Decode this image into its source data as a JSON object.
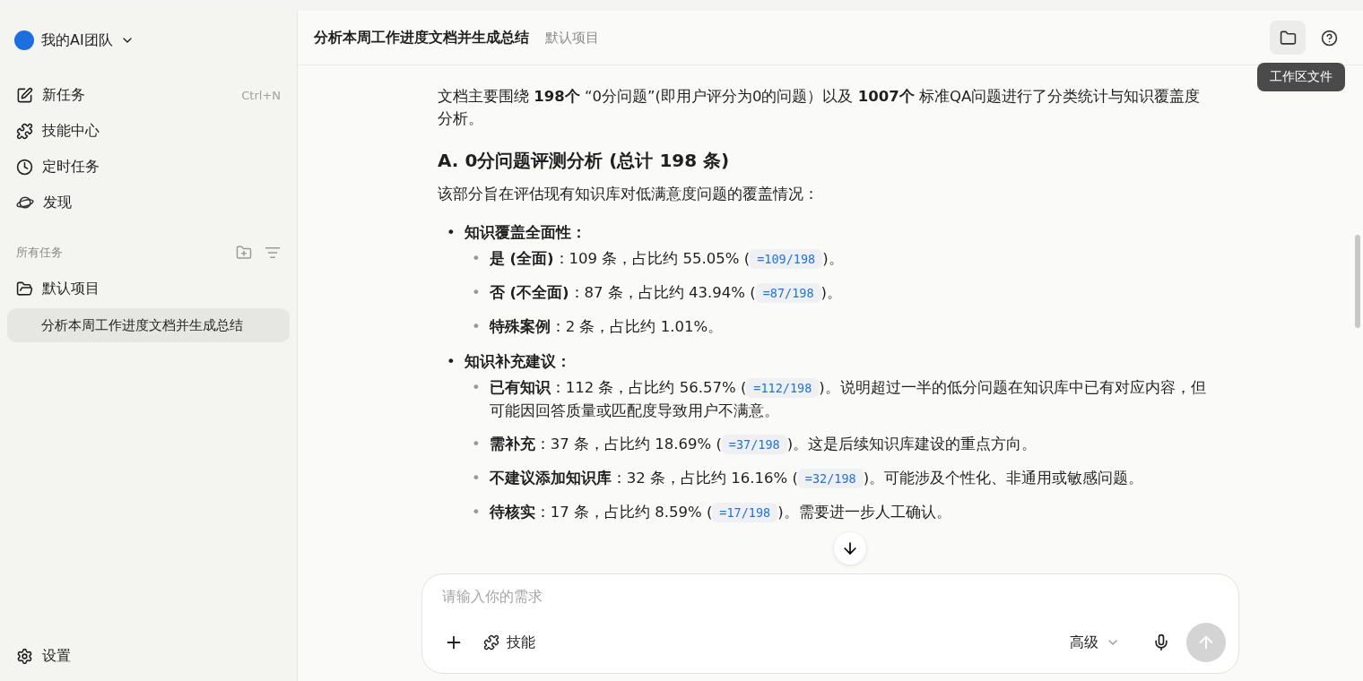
{
  "sidebar": {
    "team": "我的AI团队",
    "nav": [
      {
        "kind": "new",
        "label": "新任务",
        "shortcut": "Ctrl+N"
      },
      {
        "kind": "skills",
        "label": "技能中心"
      },
      {
        "kind": "schedule",
        "label": "定时任务"
      },
      {
        "kind": "discover",
        "label": "发现"
      }
    ],
    "section_title": "所有任务",
    "projects": [
      {
        "label": "默认项目",
        "children": [
          {
            "label": "分析本周工作进度文档并生成总结",
            "selected": true
          }
        ]
      }
    ],
    "settings": "设置"
  },
  "header": {
    "title": "分析本周工作进度文档并生成总结",
    "project": "默认项目",
    "tooltip": "工作区文件"
  },
  "document": {
    "intro": "文档主要围绕 **198个** “0分问题”(即用户评分为0的问题）以及 **1007个** 标准QA问题进行了分类统计与知识覆盖度分析。",
    "heading": "A. 0分问题评测分析 (总计 198 条)",
    "lead": "该部分旨在评估现有知识库对低满意度问题的覆盖情况：",
    "bullets": [
      {
        "marker": "•",
        "label": "知识覆盖全面性：",
        "children": [
          {
            "marker": "•",
            "text": "**是 (全面)**：109 条，占比约 55.05% (",
            "code": "=109/198",
            "after": ")。"
          },
          {
            "marker": "•",
            "text": "**否 (不全面)**：87 条，占比约 43.94% (",
            "code": "=87/198",
            "after": ")。"
          },
          {
            "marker": "•",
            "text": "**特殊案例**：2 条，占比约 1.01%。"
          }
        ]
      },
      {
        "marker": "•",
        "label": "知识补充建议：",
        "children": [
          {
            "marker": "•",
            "text": "**已有知识**：112 条，占比约 56.57% (",
            "code": "=112/198",
            "after": ")。说明超过一半的低分问题在知识库中已有对应内容，但可能因回答质量或匹配度导致用户不满意。"
          },
          {
            "marker": "•",
            "text": "**需补充**：37 条，占比约 18.69% (",
            "code": "=37/198",
            "after": ")。这是后续知识库建设的重点方向。"
          },
          {
            "marker": "•",
            "text": "**不建议添加知识库**：32 条，占比约 16.16% (",
            "code": "=32/198",
            "after": ")。可能涉及个性化、非通用或敏感问题。"
          },
          {
            "marker": "•",
            "text": "**待核实**：17 条，占比约 8.59% (",
            "code": "=17/198",
            "after": ")。需要进一步人工确认。"
          }
        ]
      }
    ]
  },
  "composer": {
    "placeholder": "请输入你的需求",
    "skill": "技能",
    "mode": "高级"
  }
}
